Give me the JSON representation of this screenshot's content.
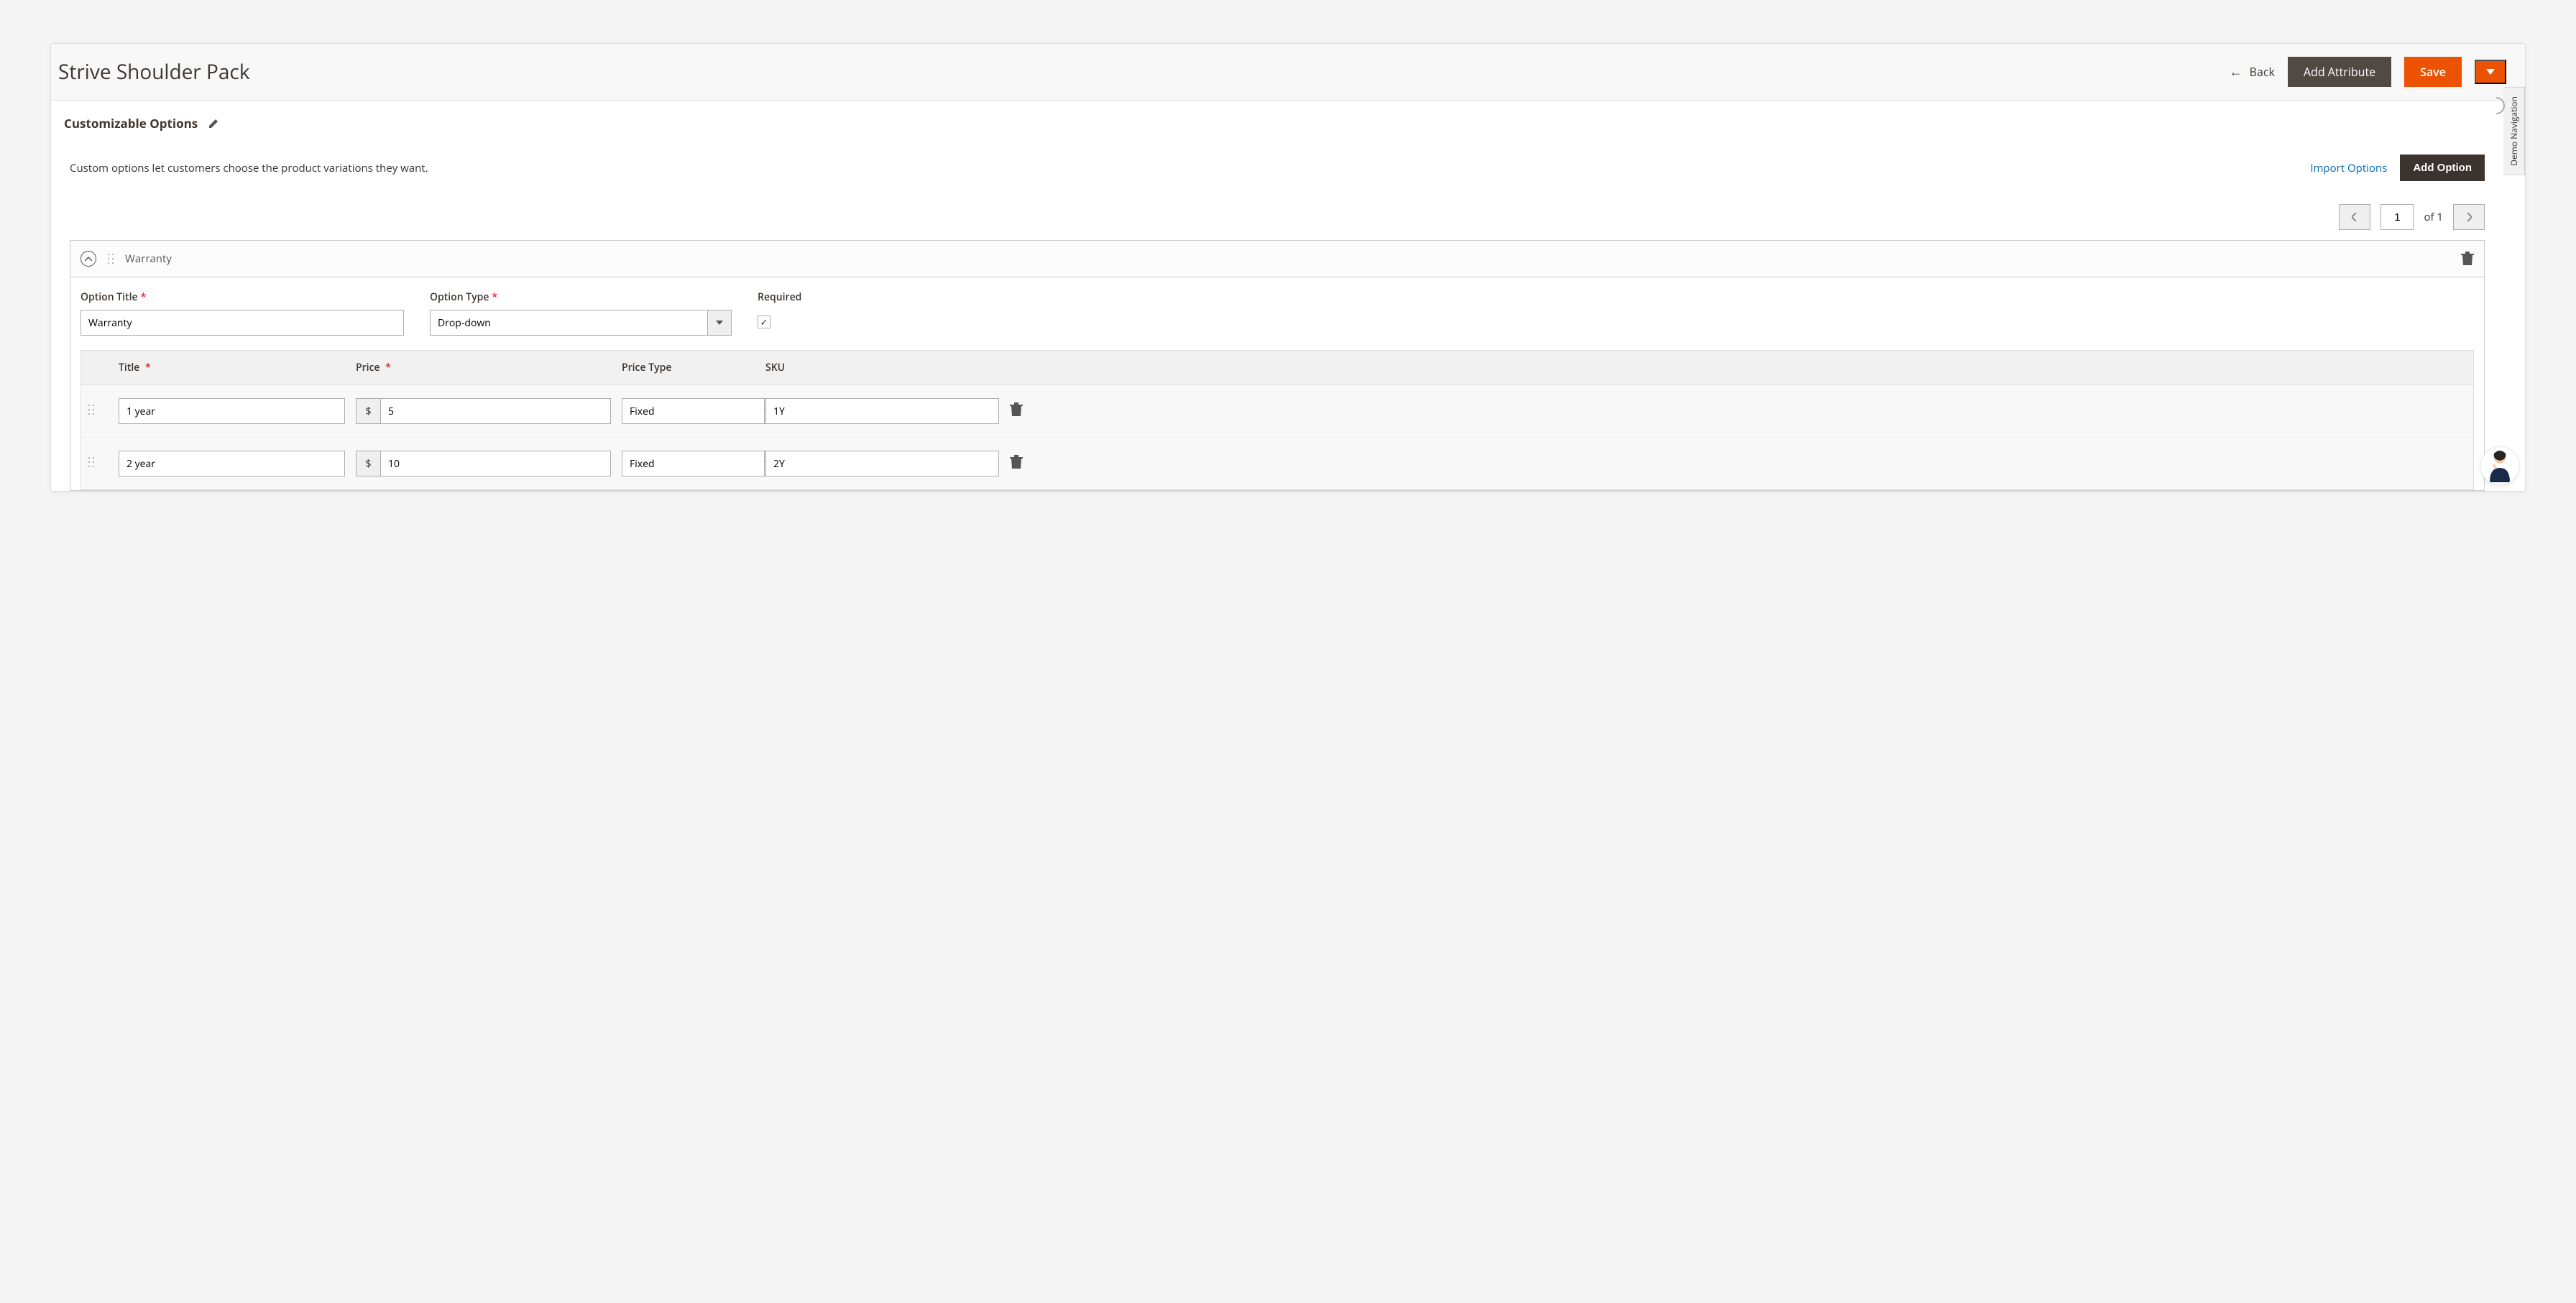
{
  "header": {
    "page_title": "Strive Shoulder Pack",
    "back_label": "Back",
    "add_attribute_label": "Add Attribute",
    "save_label": "Save"
  },
  "side_tab": "Demo Navigation",
  "section": {
    "title": "Customizable Options",
    "intro": "Custom options let customers choose the product variations they want.",
    "import_options_label": "Import Options",
    "add_option_label": "Add Option"
  },
  "pagination": {
    "current": "1",
    "total_label": "of 1"
  },
  "option": {
    "name": "Warranty",
    "fields": {
      "option_title_label": "Option Title",
      "option_title_value": "Warranty",
      "option_type_label": "Option Type",
      "option_type_value": "Drop-down",
      "required_label": "Required",
      "required_checked": true
    },
    "columns": {
      "title": "Title",
      "price": "Price",
      "price_type": "Price Type",
      "sku": "SKU"
    },
    "price_prefix": "$",
    "rows": [
      {
        "title": "1 year",
        "price": "5",
        "price_type": "Fixed",
        "sku": "1Y"
      },
      {
        "title": "2 year",
        "price": "10",
        "price_type": "Fixed",
        "sku": "2Y"
      }
    ]
  }
}
